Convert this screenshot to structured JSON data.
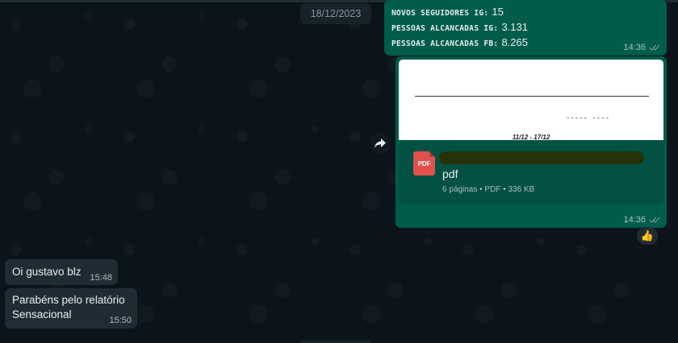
{
  "date_chip": "18/12/2023",
  "stats_message": {
    "lines": [
      {
        "label": "NOVOS SEGUIDORES IG:",
        "value": "15"
      },
      {
        "label": "PESSOAS ALCANCADAS IG:",
        "value": "3.131"
      },
      {
        "label": "PESSOAS ALCANCADAS FB:",
        "value": "8.265"
      }
    ],
    "time": "14:36"
  },
  "document_message": {
    "preview_dashes": "-----  ----",
    "preview_range": "11/12 - 17/12",
    "icon_label": "PDF",
    "title": "pdf",
    "subtitle": "6 páginas • PDF • 336 KB",
    "time": "14:36",
    "reaction": "👍"
  },
  "incoming_messages": [
    {
      "lines": [
        "Oi gustavo blz"
      ],
      "time": "15:48"
    },
    {
      "lines": [
        "Parabéns pelo relatório",
        "Sensacional"
      ],
      "time": "15:50"
    }
  ],
  "colors": {
    "background": "#0b141a",
    "outgoing_bubble": "#005c4b",
    "incoming_bubble": "#202c33",
    "read_tick": "#8696a0"
  }
}
